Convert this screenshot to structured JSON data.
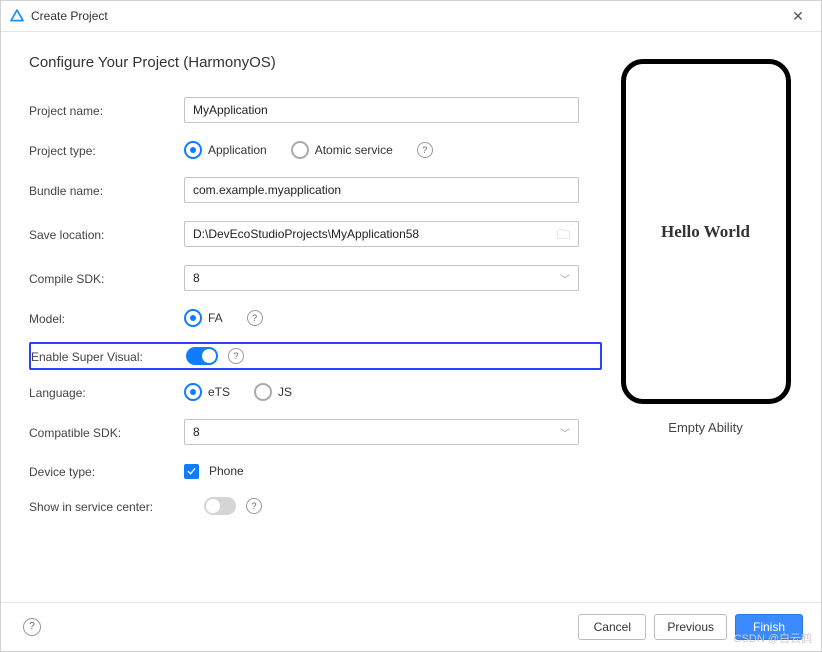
{
  "window": {
    "title": "Create Project"
  },
  "page": {
    "title": "Configure Your Project (HarmonyOS)"
  },
  "labels": {
    "project_name": "Project name:",
    "project_type": "Project type:",
    "bundle_name": "Bundle name:",
    "save_location": "Save location:",
    "compile_sdk": "Compile SDK:",
    "model": "Model:",
    "enable_super_visual": "Enable Super Visual:",
    "language": "Language:",
    "compatible_sdk": "Compatible SDK:",
    "device_type": "Device type:",
    "show_service_center": "Show in service center:"
  },
  "values": {
    "project_name": "MyApplication",
    "bundle_name": "com.example.myapplication",
    "save_location": "D:\\DevEcoStudioProjects\\MyApplication58",
    "compile_sdk": "8",
    "compatible_sdk": "8"
  },
  "project_type": {
    "options": {
      "application": "Application",
      "atomic": "Atomic service"
    },
    "selected": "application"
  },
  "model": {
    "options": {
      "fa": "FA"
    },
    "selected": "fa"
  },
  "language": {
    "options": {
      "ets": "eTS",
      "js": "JS"
    },
    "selected": "ets"
  },
  "device_type": {
    "phone": "Phone",
    "phone_checked": true
  },
  "super_visual_on": true,
  "show_service_center_on": false,
  "preview": {
    "screen_text": "Hello World",
    "caption": "Empty Ability"
  },
  "buttons": {
    "cancel": "Cancel",
    "previous": "Previous",
    "finish": "Finish"
  },
  "help_glyph": "?",
  "watermark": "CSDN @白云鹤"
}
